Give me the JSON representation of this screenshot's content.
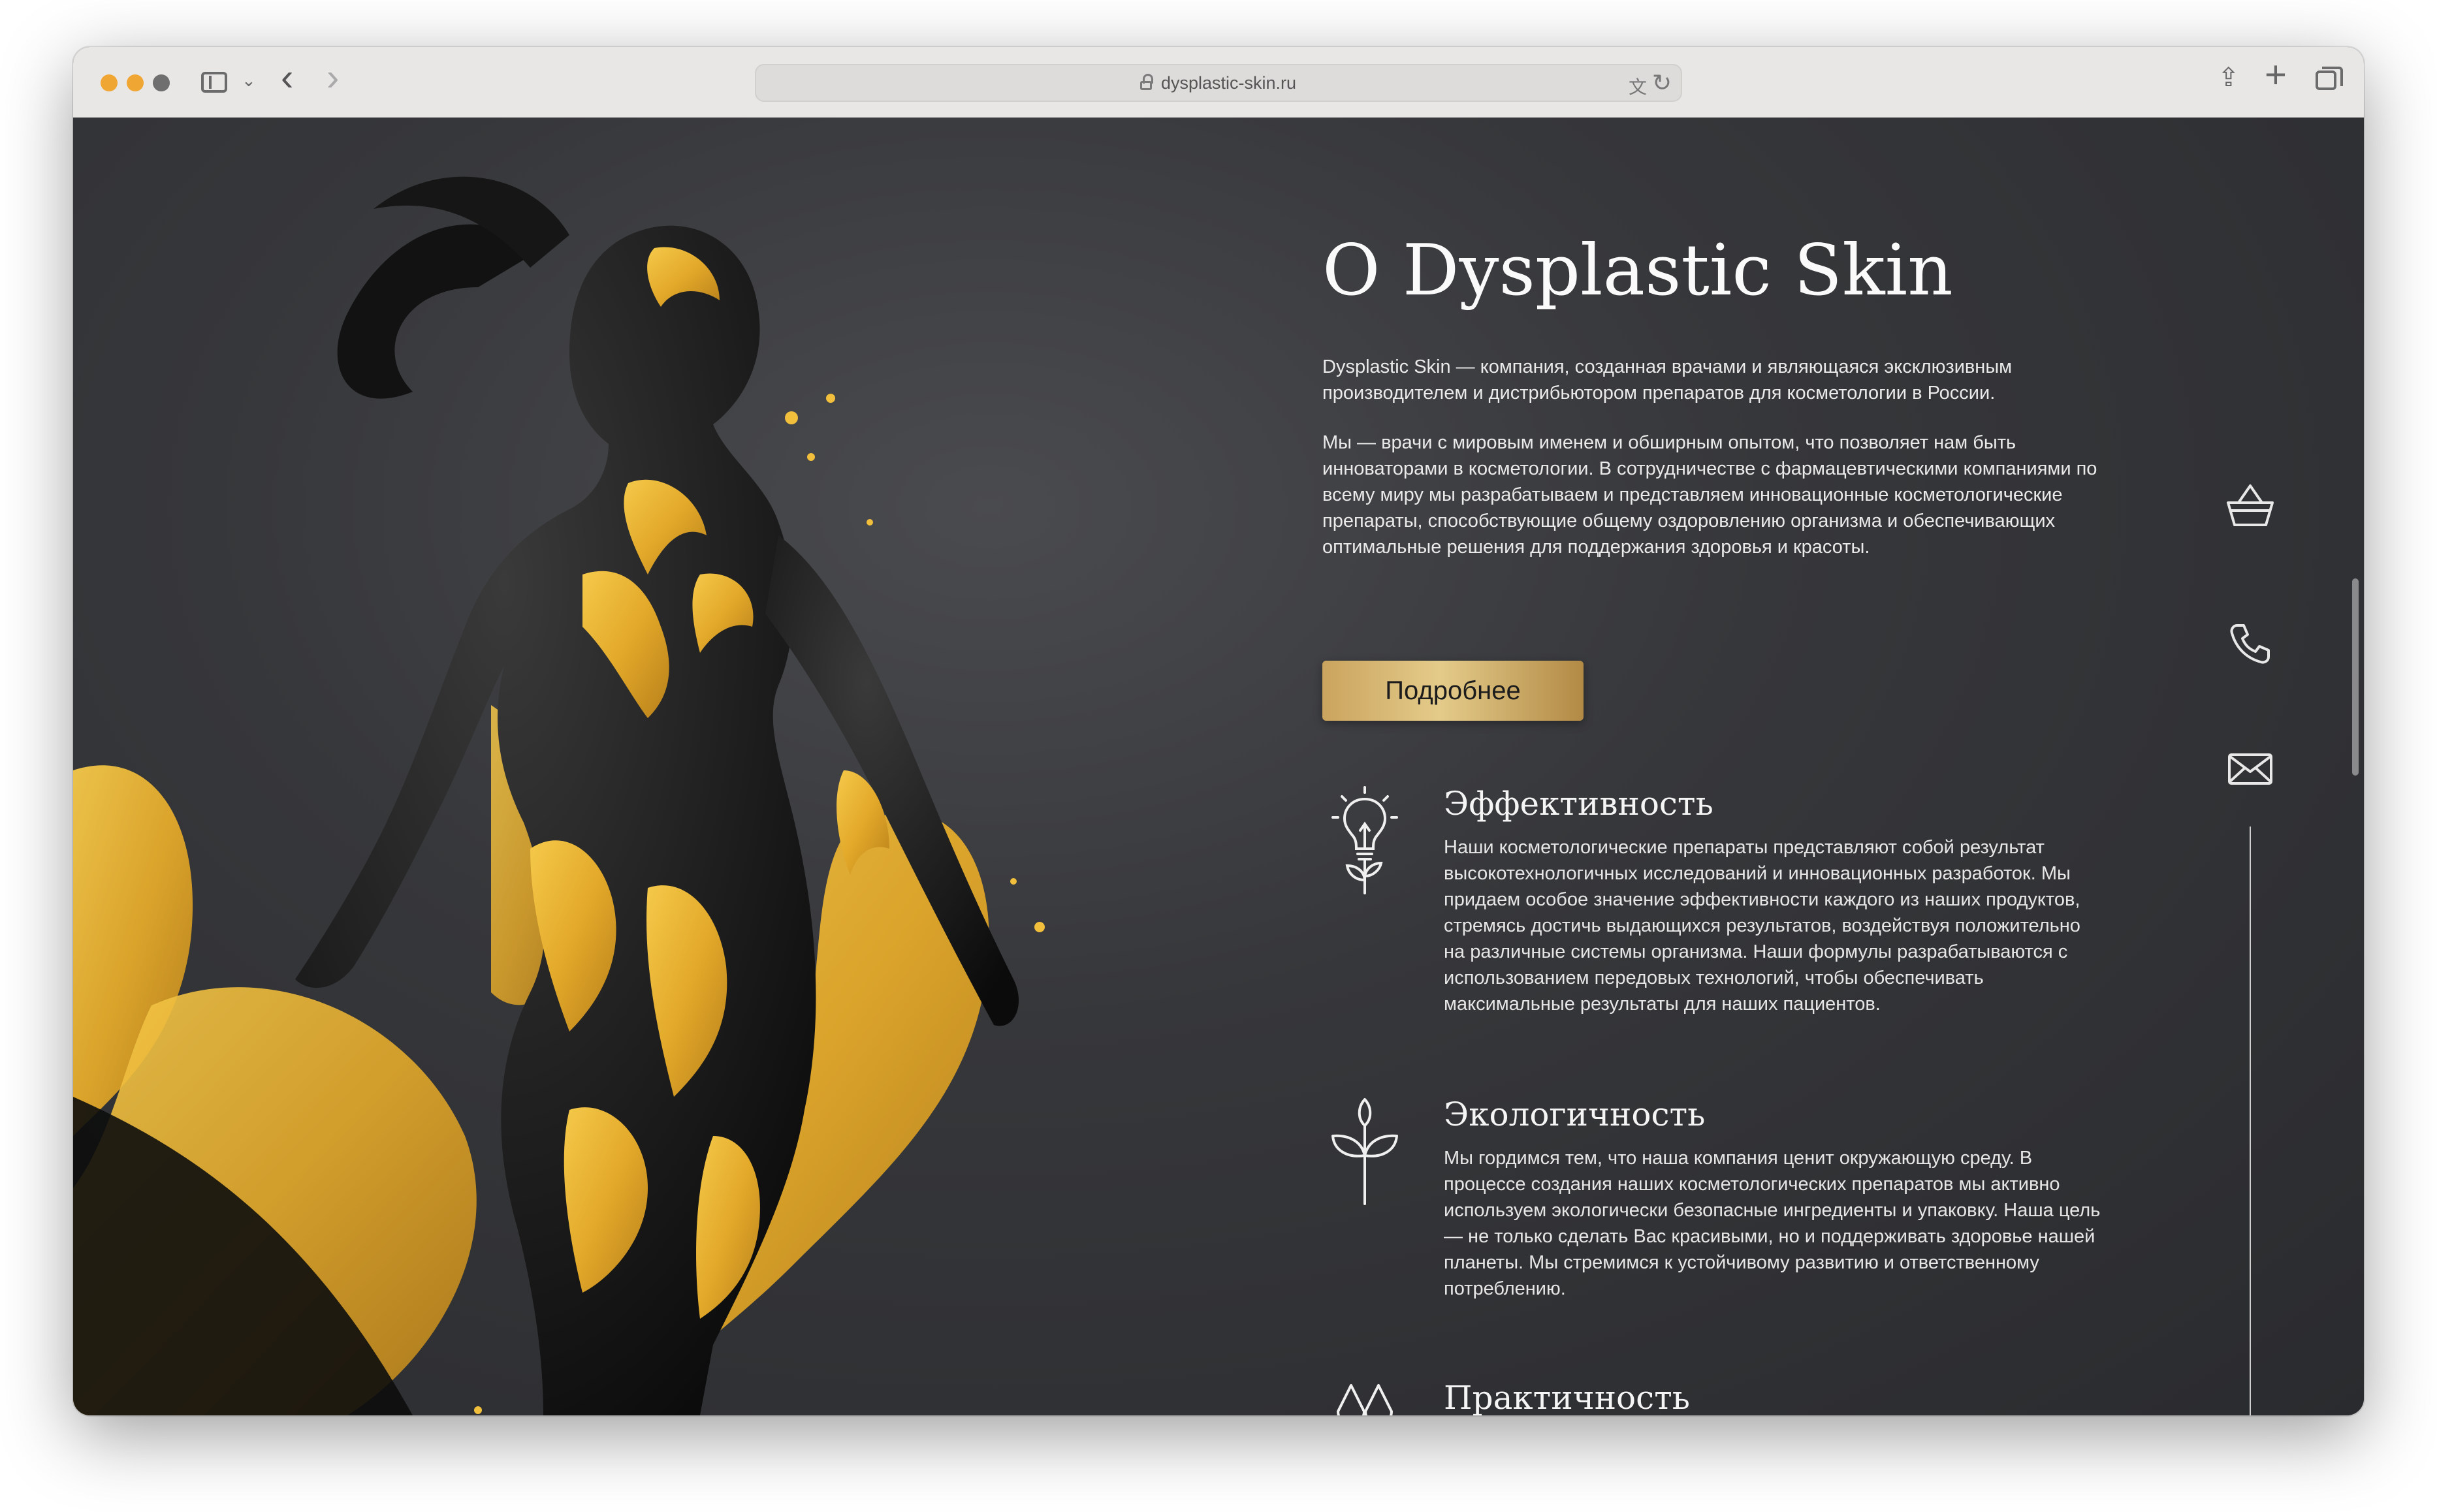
{
  "browser": {
    "url": "dysplastic-skin.ru"
  },
  "about": {
    "title": "O Dysplastic Skin",
    "paragraph1": "Dysplastic Skin — компания, созданная врачами и являющаяся эксклюзивным производителем и дистрибьютором препаратов для косметологии в России.",
    "paragraph2": "Мы — врачи с мировым именем и обширным опытом, что позволяет нам быть инноваторами в косметологии. В сотрудничестве с фармацевтическими компаниями по всему миру мы разрабатываем и представляем инновационные косметологические препараты, способствующие общему оздоровлению организма и обеспечивающих оптимальные решения для поддержания здоровья и красоты.",
    "more_button": "Подробнее"
  },
  "features": [
    {
      "title": "Эффективность",
      "text": "Наши косметологические препараты представляют собой результат высокотехнологичных исследований и инновационных разработок. Мы придаем особое значение эффективности каждого из наших продуктов, стремясь достичь выдающихся результатов, воздействуя положительно на различные системы организма. Наши формулы разрабатываются с использованием передовых технологий, чтобы обеспечивать максимальные результаты для наших пациентов.",
      "icon": "lightbulb-plant-icon"
    },
    {
      "title": "Экологичность",
      "text": "Мы гордимся тем, что наша компания ценит окружающую среду. В процессе создания наших косметологических препаратов мы активно используем экологически безопасные ингредиенты и упаковку. Наша цель — не только сделать Вас красивыми, но и поддерживать здоровье нашей планеты. Мы стремимся к устойчивому развитию и ответственному потреблению.",
      "icon": "sprout-icon"
    },
    {
      "title": "Практичность",
      "text": "",
      "icon": "drops-icon"
    }
  ],
  "colors": {
    "accent_gold": "#d4b06a",
    "background": "#333437",
    "traffic_light_active": "#f0a632"
  }
}
